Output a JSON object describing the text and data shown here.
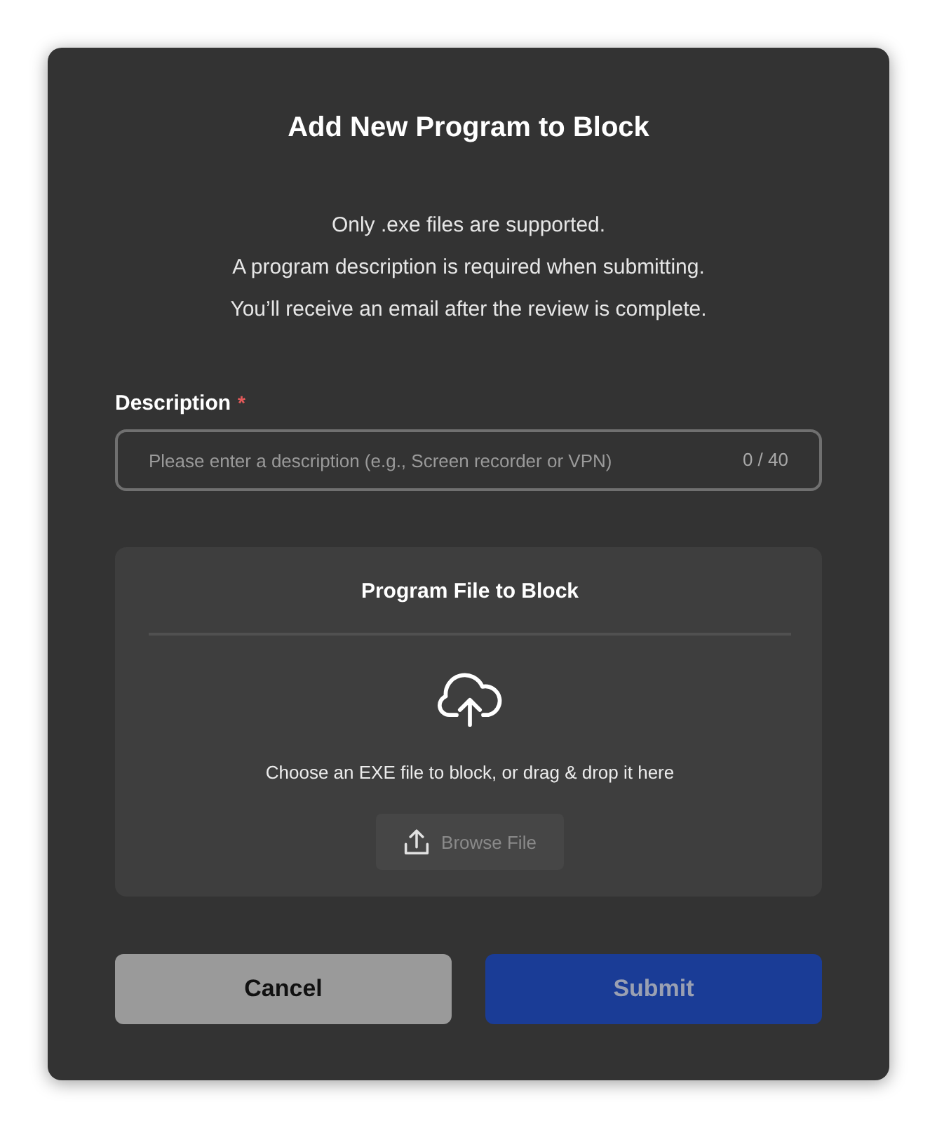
{
  "dialog": {
    "title": "Add New Program to Block",
    "notes": [
      "Only .exe files are supported.",
      "A program description is required when submitting.",
      "You’ll receive an email after the review is complete."
    ]
  },
  "description_field": {
    "label": "Description",
    "required_mark": "*",
    "placeholder": "Please enter a description (e.g., Screen recorder or VPN)",
    "counter": "0 / 40"
  },
  "upload": {
    "title": "Program File to Block",
    "hint": "Choose an EXE file to block, or drag & drop it here",
    "browse_button": {
      "label": "Browse File",
      "disabled": true
    }
  },
  "buttons": [
    {
      "kind": "secondary",
      "label": "Cancel",
      "disabled": false
    },
    {
      "kind": "primary",
      "label": "Submit",
      "disabled": true
    }
  ]
}
